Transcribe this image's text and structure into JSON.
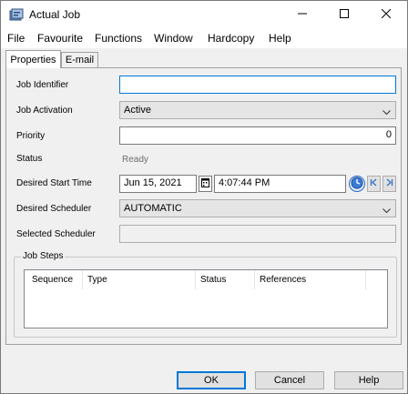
{
  "window": {
    "title": "Actual Job",
    "minimize_icon": "minimize-icon",
    "maximize_icon": "maximize-icon",
    "close_icon": "close-icon"
  },
  "menubar": {
    "items": [
      "File",
      "Favourite",
      "Functions",
      "Window",
      "Hardcopy",
      "Help"
    ]
  },
  "tabs": [
    {
      "label": "Properties",
      "active": true
    },
    {
      "label": "E-mail",
      "active": false
    }
  ],
  "form": {
    "job_identifier": {
      "label": "Job Identifier",
      "value": ""
    },
    "job_activation": {
      "label": "Job Activation",
      "value": "Active"
    },
    "priority": {
      "label": "Priority",
      "value": "0"
    },
    "status": {
      "label": "Status",
      "value": "Ready"
    },
    "desired_start_time": {
      "label": "Desired Start Time",
      "date": "Jun 15, 2021",
      "time": "4:07:44 PM"
    },
    "desired_scheduler": {
      "label": "Desired Scheduler",
      "value": "AUTOMATIC"
    },
    "selected_scheduler": {
      "label": "Selected Scheduler",
      "value": ""
    }
  },
  "job_steps": {
    "title": "Job Steps",
    "columns": [
      "Sequence",
      "Type",
      "Status",
      "References"
    ],
    "rows": []
  },
  "buttons": {
    "ok": "OK",
    "cancel": "Cancel",
    "help": "Help"
  },
  "colors": {
    "focus": "#0078d7",
    "window_bg": "#f0f0f0",
    "disabled_text": "#6d6d6d"
  }
}
